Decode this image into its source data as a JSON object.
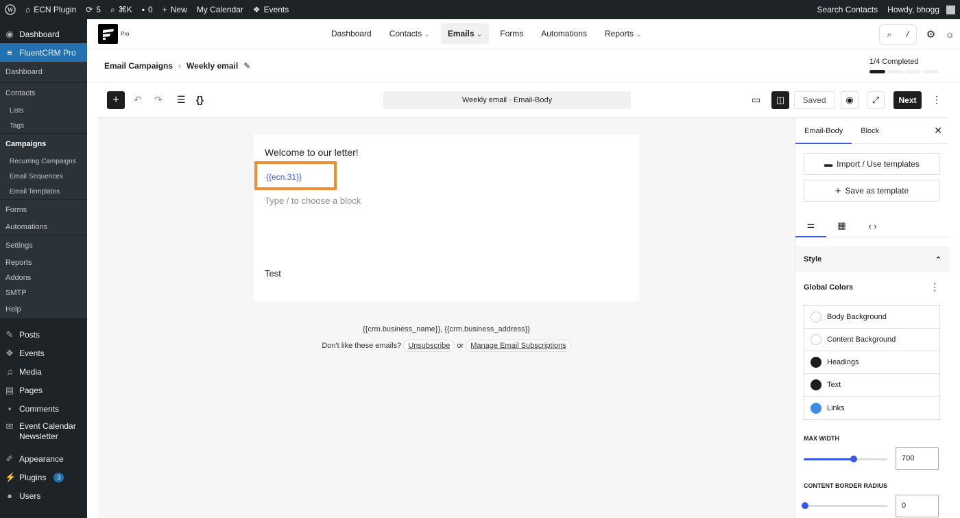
{
  "adminbar": {
    "site_name": "ECN Plugin",
    "updates_count": "5",
    "shortcut": "⌘K",
    "comments_count": "0",
    "new_label": "New",
    "my_calendar": "My Calendar",
    "events": "Events",
    "search_contacts": "Search Contacts",
    "howdy": "Howdy, bhogg"
  },
  "sidebar": {
    "dashboard": "Dashboard",
    "fluentcrm": "FluentCRM Pro",
    "sub": {
      "dashboard": "Dashboard",
      "contacts": "Contacts",
      "lists": "Lists",
      "tags": "Tags",
      "campaigns": "Campaigns",
      "recurring": "Recurring Campaigns",
      "sequences": "Email Sequences",
      "templates": "Email Templates",
      "forms": "Forms",
      "automations": "Automations",
      "settings": "Settings",
      "reports": "Reports",
      "addons": "Addons",
      "smtp": "SMTP",
      "help": "Help"
    },
    "posts": "Posts",
    "events": "Events",
    "media": "Media",
    "pages": "Pages",
    "comments": "Comments",
    "ecn_line1": "Event Calendar",
    "ecn_line2": "Newsletter",
    "appearance": "Appearance",
    "plugins": "Plugins",
    "plugins_badge": "3",
    "users": "Users"
  },
  "fcnav": {
    "logo_sub": "Pro",
    "items": [
      "Dashboard",
      "Contacts",
      "Emails",
      "Forms",
      "Automations",
      "Reports"
    ],
    "search_slash": "/"
  },
  "breadcrumb": {
    "parent": "Email Campaigns",
    "current": "Weekly email",
    "progress_label": "1/4 Completed",
    "progress_steps_done": 1,
    "progress_steps_total": 4
  },
  "toolbar": {
    "doc_title": "Weekly email · Email-Body",
    "saved": "Saved",
    "next": "Next"
  },
  "editor": {
    "welcome": "Welcome to our letter!",
    "tag": "{{ecn.31}}",
    "placeholder": "Type / to choose a block",
    "test": "Test",
    "footer_address": "{{crm.business_name}}, {{crm.business_address}}",
    "footer_prompt": "Don't like these emails?",
    "unsubscribe": "Unsubscribe",
    "or": "or",
    "manage": "Manage Email Subscriptions"
  },
  "panel": {
    "tab_body": "Email-Body",
    "tab_block": "Block",
    "import_btn": "Import / Use templates",
    "save_btn": "Save as template",
    "style": "Style",
    "global_colors": "Global Colors",
    "colors": [
      {
        "label": "Body Background",
        "color": "#ffffff"
      },
      {
        "label": "Content Background",
        "color": "#ffffff"
      },
      {
        "label": "Headings",
        "color": "#1e1e1e"
      },
      {
        "label": "Text",
        "color": "#1e1e1e"
      },
      {
        "label": "Links",
        "color": "#3a8ee6"
      }
    ],
    "max_width_label": "MAX WIDTH",
    "max_width_value": "700",
    "max_width_fraction": 0.6,
    "border_radius_label": "CONTENT BORDER RADIUS",
    "border_radius_value": "0",
    "border_radius_fraction": 0
  },
  "colors": {
    "accent": "#3858e9",
    "wp_blue": "#2271b1",
    "highlight": "#f08c31"
  }
}
